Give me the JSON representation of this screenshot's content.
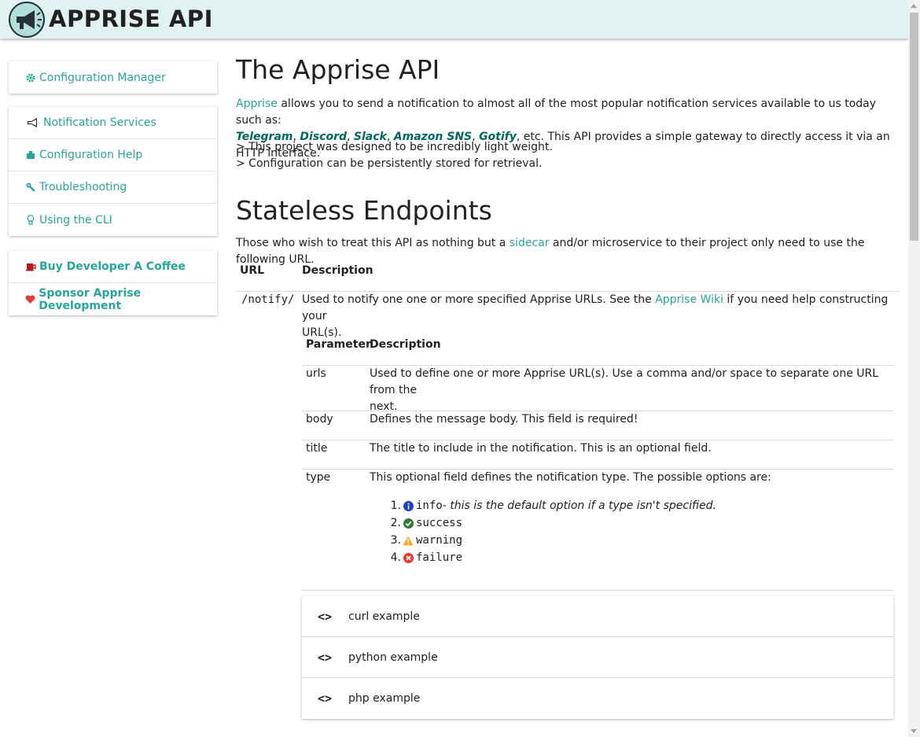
{
  "header": {
    "brand": "APPRISE API"
  },
  "sidebar": {
    "config_manager": {
      "label": "Configuration Manager",
      "icon": "gear-icon"
    },
    "help_items": [
      {
        "label": "Notification Services",
        "icon": "megaphone-icon"
      },
      {
        "label": "Configuration Help",
        "icon": "box-icon"
      },
      {
        "label": "Troubleshooting",
        "icon": "wrench-icon"
      },
      {
        "label": "Using the CLI",
        "icon": "lightbulb-icon"
      }
    ],
    "sponsor_items": [
      {
        "label": "Buy Developer A Coffee",
        "icon": "coffee-icon"
      },
      {
        "label": "Sponsor Apprise Development",
        "icon": "heart-icon"
      }
    ]
  },
  "main": {
    "title": "The Apprise API",
    "intro": {
      "link": "Apprise",
      "text1": " allows you to send a notification to almost all of the most popular notification services available to us today such as:",
      "services": [
        "Telegram",
        "Discord",
        "Slack",
        "Amazon SNS",
        "Gotify"
      ],
      "text2": ", etc. This API provides a simple gateway to directly access it via an HTTP interface."
    },
    "features": [
      "> This project was designed to be incredibly light weight.",
      "> Configuration can be persistently stored for retrieval."
    ],
    "stateless": {
      "title": "Stateless Endpoints",
      "intro_a": "Those who wish to treat this API as nothing but a ",
      "intro_link": "sidecar",
      "intro_b": " and/or microservice to their project only need to use the following URL.",
      "col_url": "URL",
      "col_desc": "Description",
      "endpoint": "/notify/",
      "endpoint_desc_a": "Used to notify one one or more specified Apprise URLs. See the ",
      "endpoint_desc_link": "Apprise Wiki",
      "endpoint_desc_b": " if you need help constructing your",
      "endpoint_desc_c": "URL(s).",
      "param_col": "Parameter",
      "param_desc_col": "Description",
      "params": [
        {
          "name": "urls",
          "desc1": "Used to define one or more Apprise URL(s). Use a comma and/or space to separate one URL from the",
          "desc2": "next."
        },
        {
          "name": "body",
          "desc1": "Defines the message body. This field is required!",
          "desc2": ""
        },
        {
          "name": "title",
          "desc1": "The title to include in the notification. This is an optional field.",
          "desc2": ""
        },
        {
          "name": "type",
          "desc1": "This optional field defines the notification type. The possible options are:",
          "desc2": ""
        }
      ],
      "types": [
        {
          "num": "1.",
          "name": "info",
          "note": " - this is the default option if a type isn't specified.",
          "icon": "info-icon",
          "color": "#1565c0"
        },
        {
          "num": "2.",
          "name": "success",
          "note": "",
          "icon": "check-circle-icon",
          "color": "#2e7d32"
        },
        {
          "num": "3.",
          "name": "warning",
          "note": "",
          "icon": "warning-icon",
          "color": "#f9a825"
        },
        {
          "num": "4.",
          "name": "failure",
          "note": "",
          "icon": "error-circle-icon",
          "color": "#e53935"
        }
      ],
      "examples": [
        {
          "icon": "<>",
          "label": "curl example"
        },
        {
          "icon": "<>",
          "label": "python example"
        },
        {
          "icon": "<>",
          "label": "php example"
        }
      ]
    }
  }
}
